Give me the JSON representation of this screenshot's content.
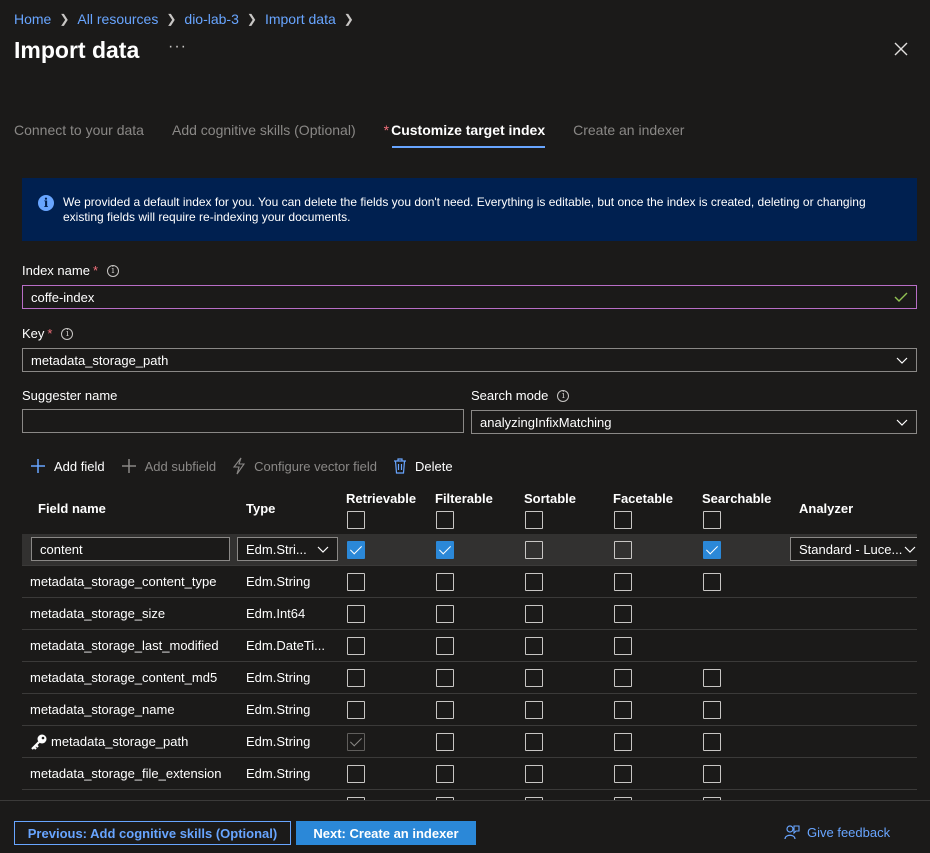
{
  "breadcrumb": [
    "Home",
    "All resources",
    "dio-lab-3",
    "Import data"
  ],
  "page": {
    "title": "Import data",
    "more": "···"
  },
  "tabs": [
    {
      "label": "Connect to your data",
      "active": false,
      "required": false
    },
    {
      "label": "Add cognitive skills (Optional)",
      "active": false,
      "required": false
    },
    {
      "label": "Customize target index",
      "active": true,
      "required": true
    },
    {
      "label": "Create an indexer",
      "active": false,
      "required": false
    }
  ],
  "info": {
    "icon": "info-icon",
    "text": "We provided a default index for you. You can delete the fields you don't need. Everything is editable, but once the index is created, deleting or changing existing fields will require re-indexing your documents."
  },
  "form": {
    "index_name_label": "Index name",
    "index_name_value": "coffe-index",
    "key_label": "Key",
    "key_value": "metadata_storage_path",
    "suggester_label": "Suggester name",
    "suggester_value": "",
    "search_mode_label": "Search mode",
    "search_mode_value": "analyzingInfixMatching"
  },
  "toolbar": {
    "add_field": "Add field",
    "add_subfield": "Add subfield",
    "configure_vector": "Configure vector field",
    "delete": "Delete"
  },
  "table": {
    "headers": {
      "field_name": "Field name",
      "type": "Type",
      "retrievable": "Retrievable",
      "filterable": "Filterable",
      "sortable": "Sortable",
      "facetable": "Facetable",
      "searchable": "Searchable",
      "analyzer": "Analyzer"
    },
    "rows": [
      {
        "name": "content",
        "type": "Edm.Stri...",
        "retrievable": "on",
        "filterable": "on",
        "sortable": "off",
        "facetable": "off",
        "searchable": "on",
        "analyzer": "Standard - Luce...",
        "editing": true
      },
      {
        "name": "metadata_storage_content_type",
        "type": "Edm.String",
        "retrievable": "off",
        "filterable": "off",
        "sortable": "off",
        "facetable": "off",
        "searchable": "off"
      },
      {
        "name": "metadata_storage_size",
        "type": "Edm.Int64",
        "retrievable": "off",
        "filterable": "off",
        "sortable": "off",
        "facetable": "off",
        "searchable": "none"
      },
      {
        "name": "metadata_storage_last_modified",
        "type": "Edm.DateTi...",
        "retrievable": "off",
        "filterable": "off",
        "sortable": "off",
        "facetable": "off",
        "searchable": "none"
      },
      {
        "name": "metadata_storage_content_md5",
        "type": "Edm.String",
        "retrievable": "off",
        "filterable": "off",
        "sortable": "off",
        "facetable": "off",
        "searchable": "off"
      },
      {
        "name": "metadata_storage_name",
        "type": "Edm.String",
        "retrievable": "off",
        "filterable": "off",
        "sortable": "off",
        "facetable": "off",
        "searchable": "off"
      },
      {
        "name": "metadata_storage_path",
        "type": "Edm.String",
        "retrievable": "disabled",
        "filterable": "off",
        "sortable": "off",
        "facetable": "off",
        "searchable": "off",
        "key": true
      },
      {
        "name": "metadata_storage_file_extension",
        "type": "Edm.String",
        "retrievable": "off",
        "filterable": "off",
        "sortable": "off",
        "facetable": "off",
        "searchable": "off"
      }
    ]
  },
  "footer": {
    "previous": "Previous: Add cognitive skills (Optional)",
    "next": "Next: Create an indexer",
    "feedback": "Give feedback"
  }
}
